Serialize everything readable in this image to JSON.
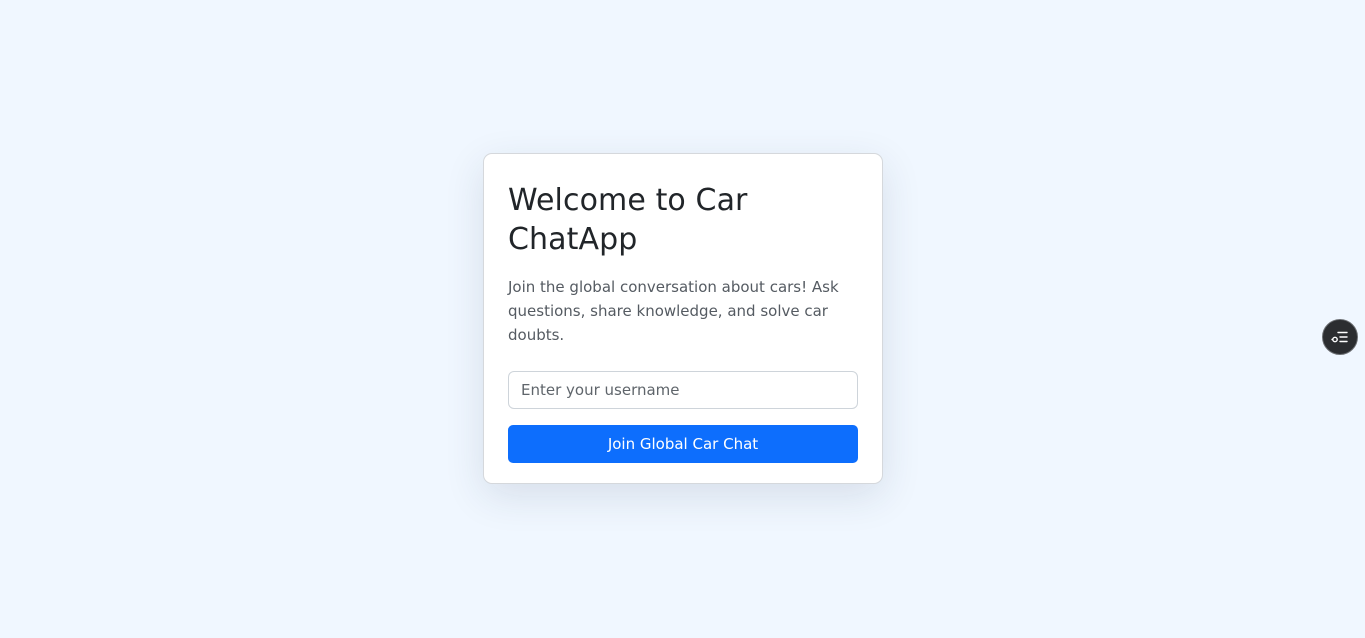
{
  "login_card": {
    "title": "Welcome to Car ChatApp",
    "description": "Join the global conversation about cars! Ask questions, share knowledge, and solve car doubts.",
    "username_placeholder": "Enter your username",
    "username_value": "",
    "join_button_label": "Join Global Car Chat"
  },
  "floating_widget": {
    "icon": "list-settings-icon"
  },
  "colors": {
    "background": "#f0f7ff",
    "primary": "#0d6efd",
    "card": "#ffffff",
    "widget": "#2b2d30"
  }
}
